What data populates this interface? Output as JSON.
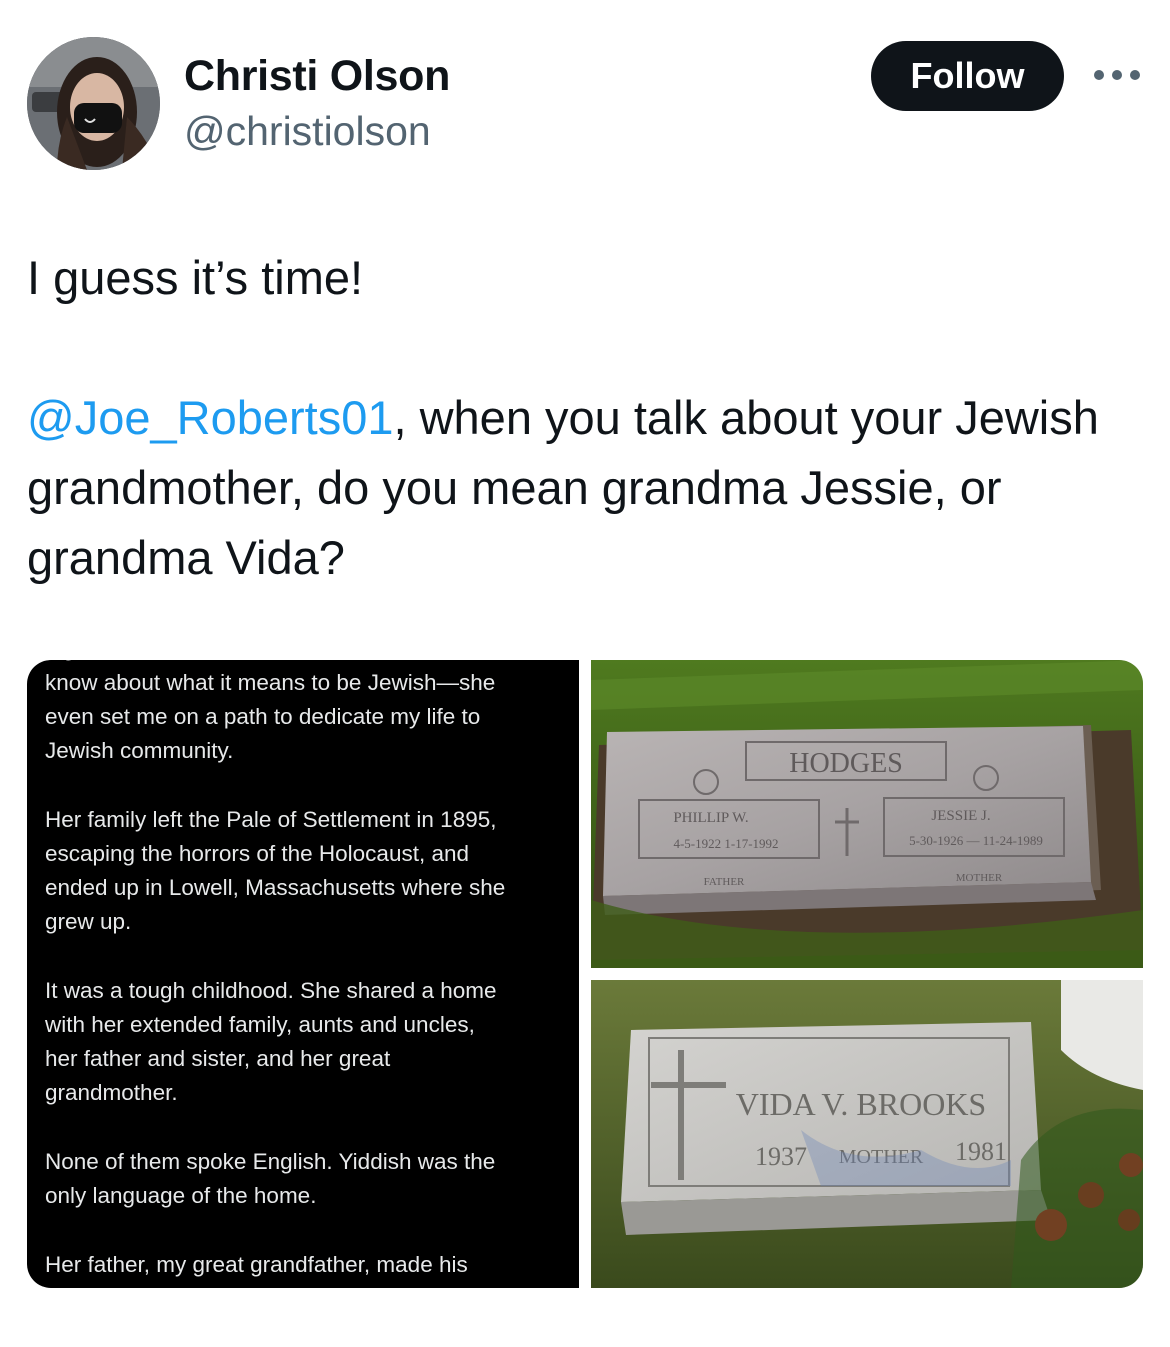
{
  "author": {
    "name": "Christi Olson",
    "handle": "@christiolson"
  },
  "follow_label": "Follow",
  "tweet": {
    "line1": "I guess it’s time!",
    "mention": "@Joe_Roberts01",
    "rest": ", when you talk about your Jewish grandmother, do you mean grandma Jessie, or grandma Vida?"
  },
  "media": {
    "screenshot_lines": [
      "know about what it means to be Jewish—she",
      "even set me on a path to dedicate my life to",
      "Jewish community.",
      "",
      "Her family left the Pale of Settlement in 1895,",
      "escaping the horrors of the Holocaust, and",
      "ended up in Lowell, Massachusetts where she",
      "grew up.",
      "",
      "It was a tough childhood. She shared a home",
      "with her extended family, aunts and uncles,",
      "her father and sister, and her great",
      "grandmother.",
      "",
      "None of them spoke English. Yiddish was the",
      "only language of the home.",
      "",
      "Her father, my great grandfather, made his"
    ],
    "hodges_stone": {
      "family": "HODGES",
      "left_name": "PHILLIP W.",
      "left_dates": "4-5-1922    1-17-1992",
      "left_role": "FATHER",
      "right_name": "JESSIE J.",
      "right_dates": "5-30-1926 — 11-24-1989",
      "right_role": "MOTHER"
    },
    "brooks_stone": {
      "name": "VIDA  V.  BROOKS",
      "birth": "1937",
      "role": "MOTHER",
      "death": "1981"
    }
  },
  "colors": {
    "mention": "#1d9bf0",
    "follow_bg": "#0f1419",
    "secondary_text": "#536471"
  }
}
